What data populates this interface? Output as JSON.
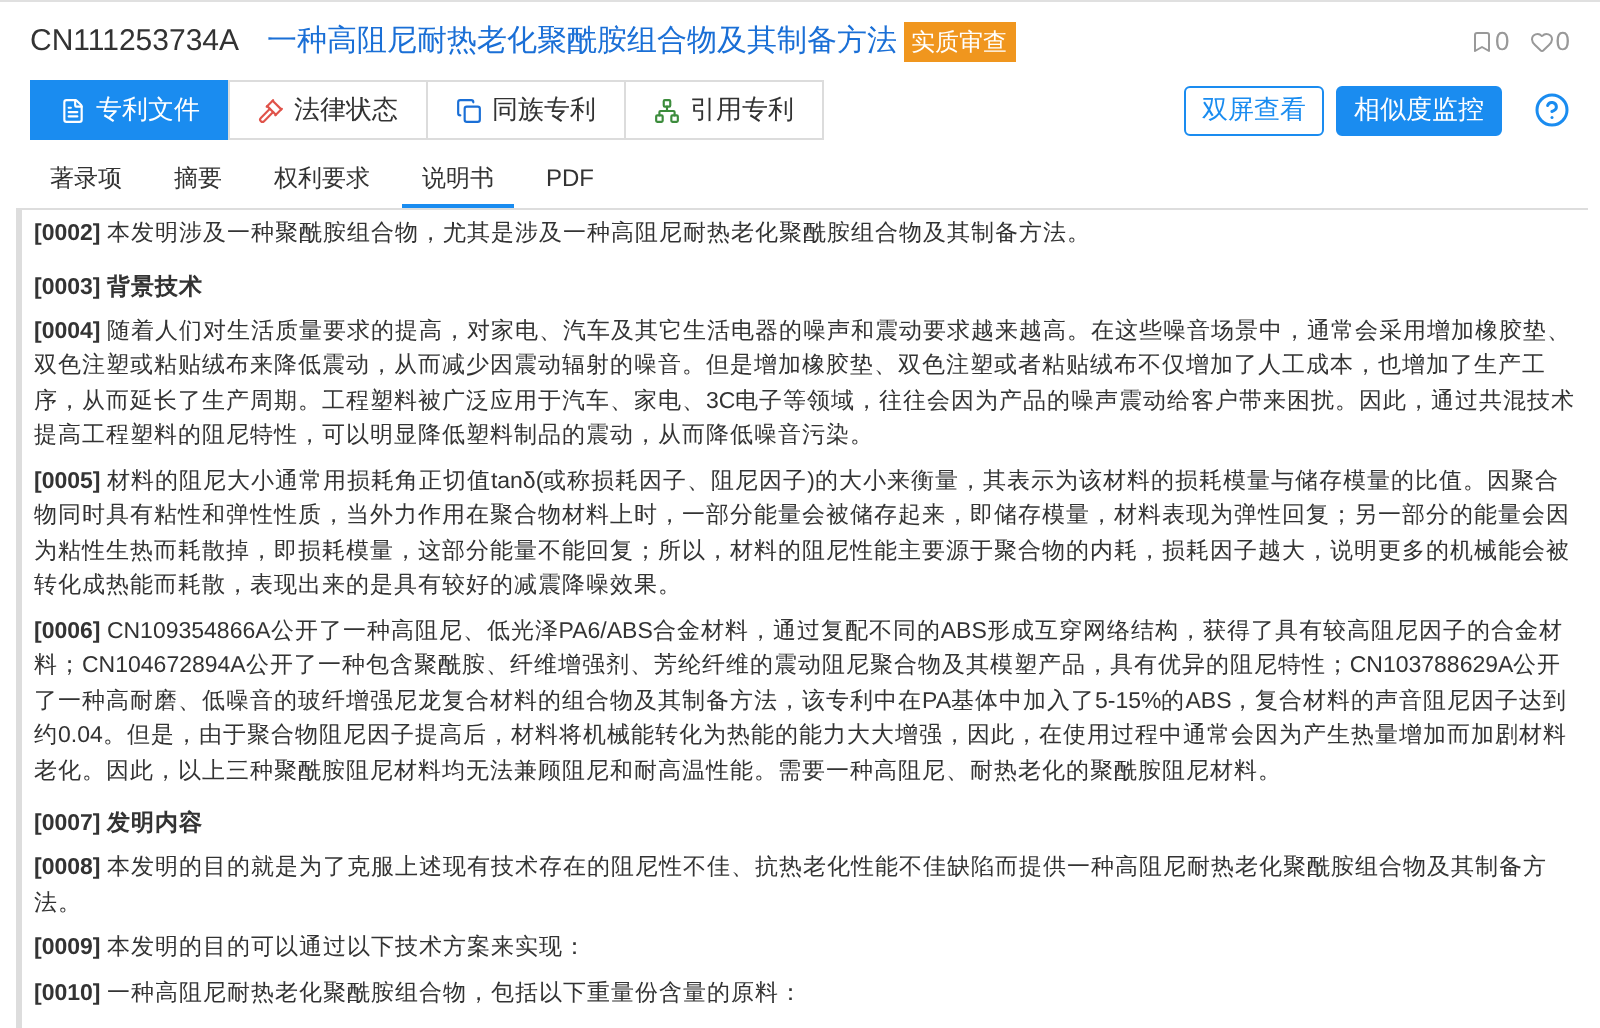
{
  "header": {
    "number": "CN111253734A",
    "title": "一种高阻尼耐热老化聚酰胺组合物及其制备方法",
    "badge": "实质审查",
    "bookmarks": "0",
    "likes": "0"
  },
  "main_tabs": [
    {
      "label": "专利文件",
      "selected": true
    },
    {
      "label": "法律状态",
      "selected": false
    },
    {
      "label": "同族专利",
      "selected": false
    },
    {
      "label": "引用专利",
      "selected": false
    }
  ],
  "actions": [
    {
      "label": "双屏查看",
      "kind": "outline"
    },
    {
      "label": "相似度监控",
      "kind": "primary"
    }
  ],
  "sub_tabs": [
    {
      "label": "著录项",
      "selected": false
    },
    {
      "label": "摘要",
      "selected": false
    },
    {
      "label": "权利要求",
      "selected": false
    },
    {
      "label": "说明书",
      "selected": true
    },
    {
      "label": "PDF",
      "selected": false
    }
  ],
  "paragraphs": [
    {
      "kind": "text",
      "text": "**[0002]** 本发明涉及一种聚酰胺组合物，尤其是涉及一种高阻尼耐热老化聚酰胺组合物及其制备方法。"
    },
    {
      "kind": "heading",
      "text": "[0003] 背景技术"
    },
    {
      "kind": "text",
      "text": "**[0004]** 随着人们对生活质量要求的提高，对家电、汽车及其它生活电器的噪声和震动要求越来越高。在这些噪音场景中，通常会采用增加橡胶垫、双色注塑或粘贴绒布来降低震动，从而减少因震动辐射的噪音。但是增加橡胶垫、双色注塑或者粘贴绒布不仅增加了人工成本，也增加了生产工序，从而延长了生产周期。工程塑料被广泛应用于汽车、家电、3C电子等领域，往往会因为产品的噪声震动给客户带来困扰。因此，通过共混技术提高工程塑料的阻尼特性，可以明显降低塑料制品的震动，从而降低噪音污染。"
    },
    {
      "kind": "text",
      "text": "**[0005]** 材料的阻尼大小通常用损耗角正切值tanδ(或称损耗因子、阻尼因子)的大小来衡量，其表示为该材料的损耗模量与储存模量的比值。因聚合物同时具有粘性和弹性性质，当外力作用在聚合物材料上时，一部分能量会被储存起来，即储存模量，材料表现为弹性回复；另一部分的能量会因为粘性生热而耗散掉，即损耗模量，这部分能量不能回复；所以，材料的阻尼性能主要源于聚合物的内耗，损耗因子越大，说明更多的机械能会被转化成热能而耗散，表现出来的是具有较好的减震降噪效果。"
    },
    {
      "kind": "text",
      "text": "**[0006]** CN109354866A公开了一种高阻尼、低光泽PA6/ABS合金材料，通过复配不同的ABS形成互穿网络结构，获得了具有较高阻尼因子的合金材料；CN104672894A公开了一种包含聚酰胺、纤维增强剂、芳纶纤维的震动阻尼聚合物及其模塑产品，具有优异的阻尼特性；CN103788629A公开了一种高耐磨、低噪音的玻纤增强尼龙复合材料的组合物及其制备方法，该专利中在PA基体中加入了5-15%的ABS，复合材料的声音阻尼因子达到约0.04。但是，由于聚合物阻尼因子提高后，材料将机械能转化为热能的能力大大增强，因此，在使用过程中通常会因为产生热量增加而加剧材料老化。因此，以上三种聚酰胺阻尼材料均无法兼顾阻尼和耐高温性能。需要一种高阻尼、耐热老化的聚酰胺阻尼材料。"
    },
    {
      "kind": "heading",
      "text": "[0007] 发明内容"
    },
    {
      "kind": "text",
      "text": "**[0008]** 本发明的目的就是为了克服上述现有技术存在的阻尼性不佳、抗热老化性能不佳缺陷而提供一种高阻尼耐热老化聚酰胺组合物及其制备方法。"
    },
    {
      "kind": "text",
      "text": "**[0009]** 本发明的目的可以通过以下技术方案来实现："
    },
    {
      "kind": "text",
      "text": "**[0010]** 一种高阻尼耐热老化聚酰胺组合物，包括以下重量份含量的原料："
    }
  ]
}
